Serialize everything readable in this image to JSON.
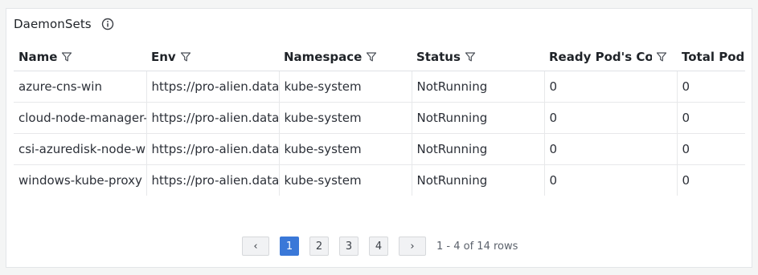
{
  "panel": {
    "title": "DaemonSets"
  },
  "table": {
    "columns": [
      "Name",
      "Env",
      "Namespace",
      "Status",
      "Ready Pod's Count",
      "Total Pod's"
    ],
    "rows": [
      [
        "azure-cns-win",
        "https://pro-alien.datadog",
        "kube-system",
        "NotRunning",
        "0",
        "0"
      ],
      [
        "cloud-node-manager-windows",
        "https://pro-alien.datadog",
        "kube-system",
        "NotRunning",
        "0",
        "0"
      ],
      [
        "csi-azuredisk-node-win",
        "https://pro-alien.datadog",
        "kube-system",
        "NotRunning",
        "0",
        "0"
      ],
      [
        "windows-kube-proxy",
        "https://pro-alien.datadog",
        "kube-system",
        "NotRunning",
        "0",
        "0"
      ]
    ]
  },
  "pagination": {
    "prev": "‹",
    "pages": [
      "1",
      "2",
      "3",
      "4"
    ],
    "active_page": "1",
    "next": "›",
    "summary": "1 - 4 of 14 rows"
  },
  "colors": {
    "accent": "#3a78d8"
  }
}
